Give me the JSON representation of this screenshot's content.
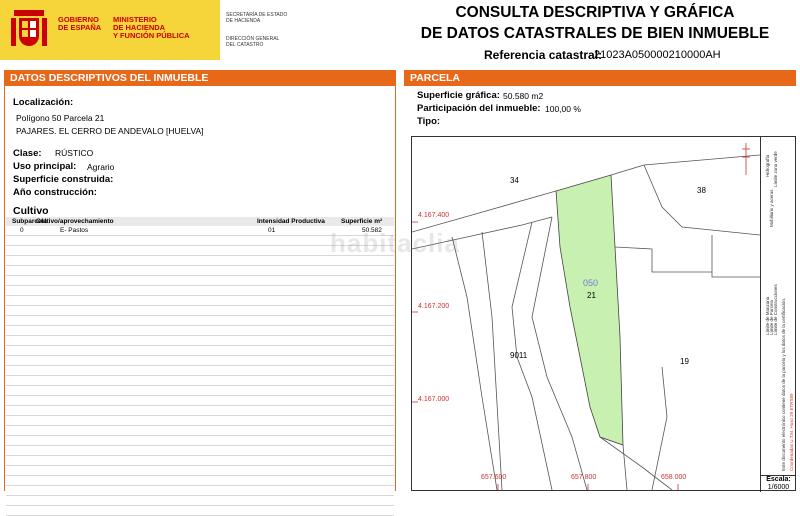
{
  "header": {
    "gov_lines": "GOBIERNO\nDE ESPAÑA",
    "ministry_lines": "MINISTERIO\nDE HACIENDA\nY FUNCIÓN PÚBLICA",
    "secretariat_lines": "SECRETARÍA DE ESTADO\nDE HACIENDA",
    "directorate_lines": "DIRECCIÓN GENERAL\nDEL CATASTRO",
    "title_line1": "CONSULTA DESCRIPTIVA Y GRÁFICA",
    "title_line2": "DE DATOS CATASTRALES DE BIEN INMUEBLE",
    "ref_label": "Referencia catastral:",
    "ref_value": "21023A050000210000AH"
  },
  "left": {
    "section_title": "DATOS DESCRIPTIVOS DEL INMUEBLE",
    "location_label": "Localización:",
    "location_line1": "Polígono 50 Parcela 21",
    "location_line2": "PAJARES. EL CERRO DE ANDEVALO [HUELVA]",
    "class_label": "Clase:",
    "class_value": "RÚSTICO",
    "use_label": "Uso principal:",
    "use_value": "Agrario",
    "built_area_label": "Superficie construida:",
    "year_label": "Año construcción:",
    "crop_title": "Cultivo",
    "table_headers": {
      "subparcela": "Subparcela",
      "cultivo": "Cultivo/aprovechamiento",
      "intensidad": "Intensidad Productiva",
      "superficie": "Superficie m²"
    },
    "table_rows": [
      {
        "subparcela": "0",
        "cultivo": "E- Pastos",
        "intensidad": "01",
        "superficie": "50.582"
      }
    ]
  },
  "right": {
    "section_title": "PARCELA",
    "surface_label": "Superficie gráfica:",
    "surface_value": "50.580 m2",
    "share_label": "Participación del inmueble:",
    "share_value": "100,00 %",
    "type_label": "Tipo:"
  },
  "map": {
    "parcel_labels": [
      "34",
      "38",
      "21",
      "19",
      "9011"
    ],
    "parcel_code": "050",
    "y_coords": [
      "4.167.400",
      "4.167.200",
      "4.167.000"
    ],
    "x_coords": [
      "657.600",
      "657.800",
      "658.000"
    ],
    "legend_lines": [
      "Límite de Manzana",
      "Límite de Parcela",
      "Límite de Construcciones",
      "Mobiliario y aceras",
      "Límite zona verde",
      "Hidrografía",
      "Este documento electrónico contiene datos de la parcela y los datos de la certificación.",
      "Coordenadas U.T.M. Huso 29 ETRS89"
    ],
    "scale_label": "Escala:",
    "scale_value": "1/6000",
    "parcel_fill": "#c8f0b0",
    "accent": "#e8681a"
  },
  "watermark": "habitaclia"
}
